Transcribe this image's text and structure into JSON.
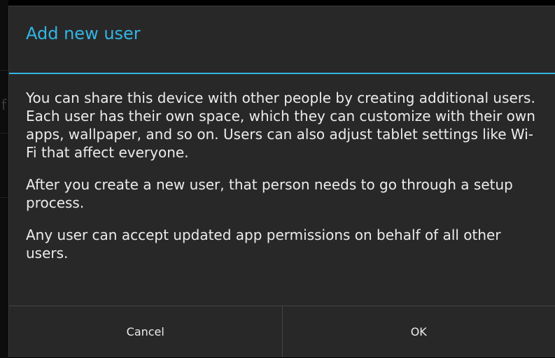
{
  "dialog": {
    "title": "Add new user",
    "paragraphs": [
      "You can share this device with other people by creating additional users. Each user has their own space, which they can customize with their own apps, wallpaper, and so on. Users can also adjust tablet settings like Wi-Fi that affect everyone.",
      "After you create a new user, that person needs to go through a setup process.",
      "Any user can accept updated app permissions on behalf of all other users."
    ],
    "buttons": {
      "cancel_label": "Cancel",
      "ok_label": "OK"
    }
  },
  "background": {
    "partial_text": "f"
  },
  "colors": {
    "accent": "#33b5e5",
    "dialog_background": "#282828",
    "text": "#ececec",
    "divider": "#454545"
  }
}
